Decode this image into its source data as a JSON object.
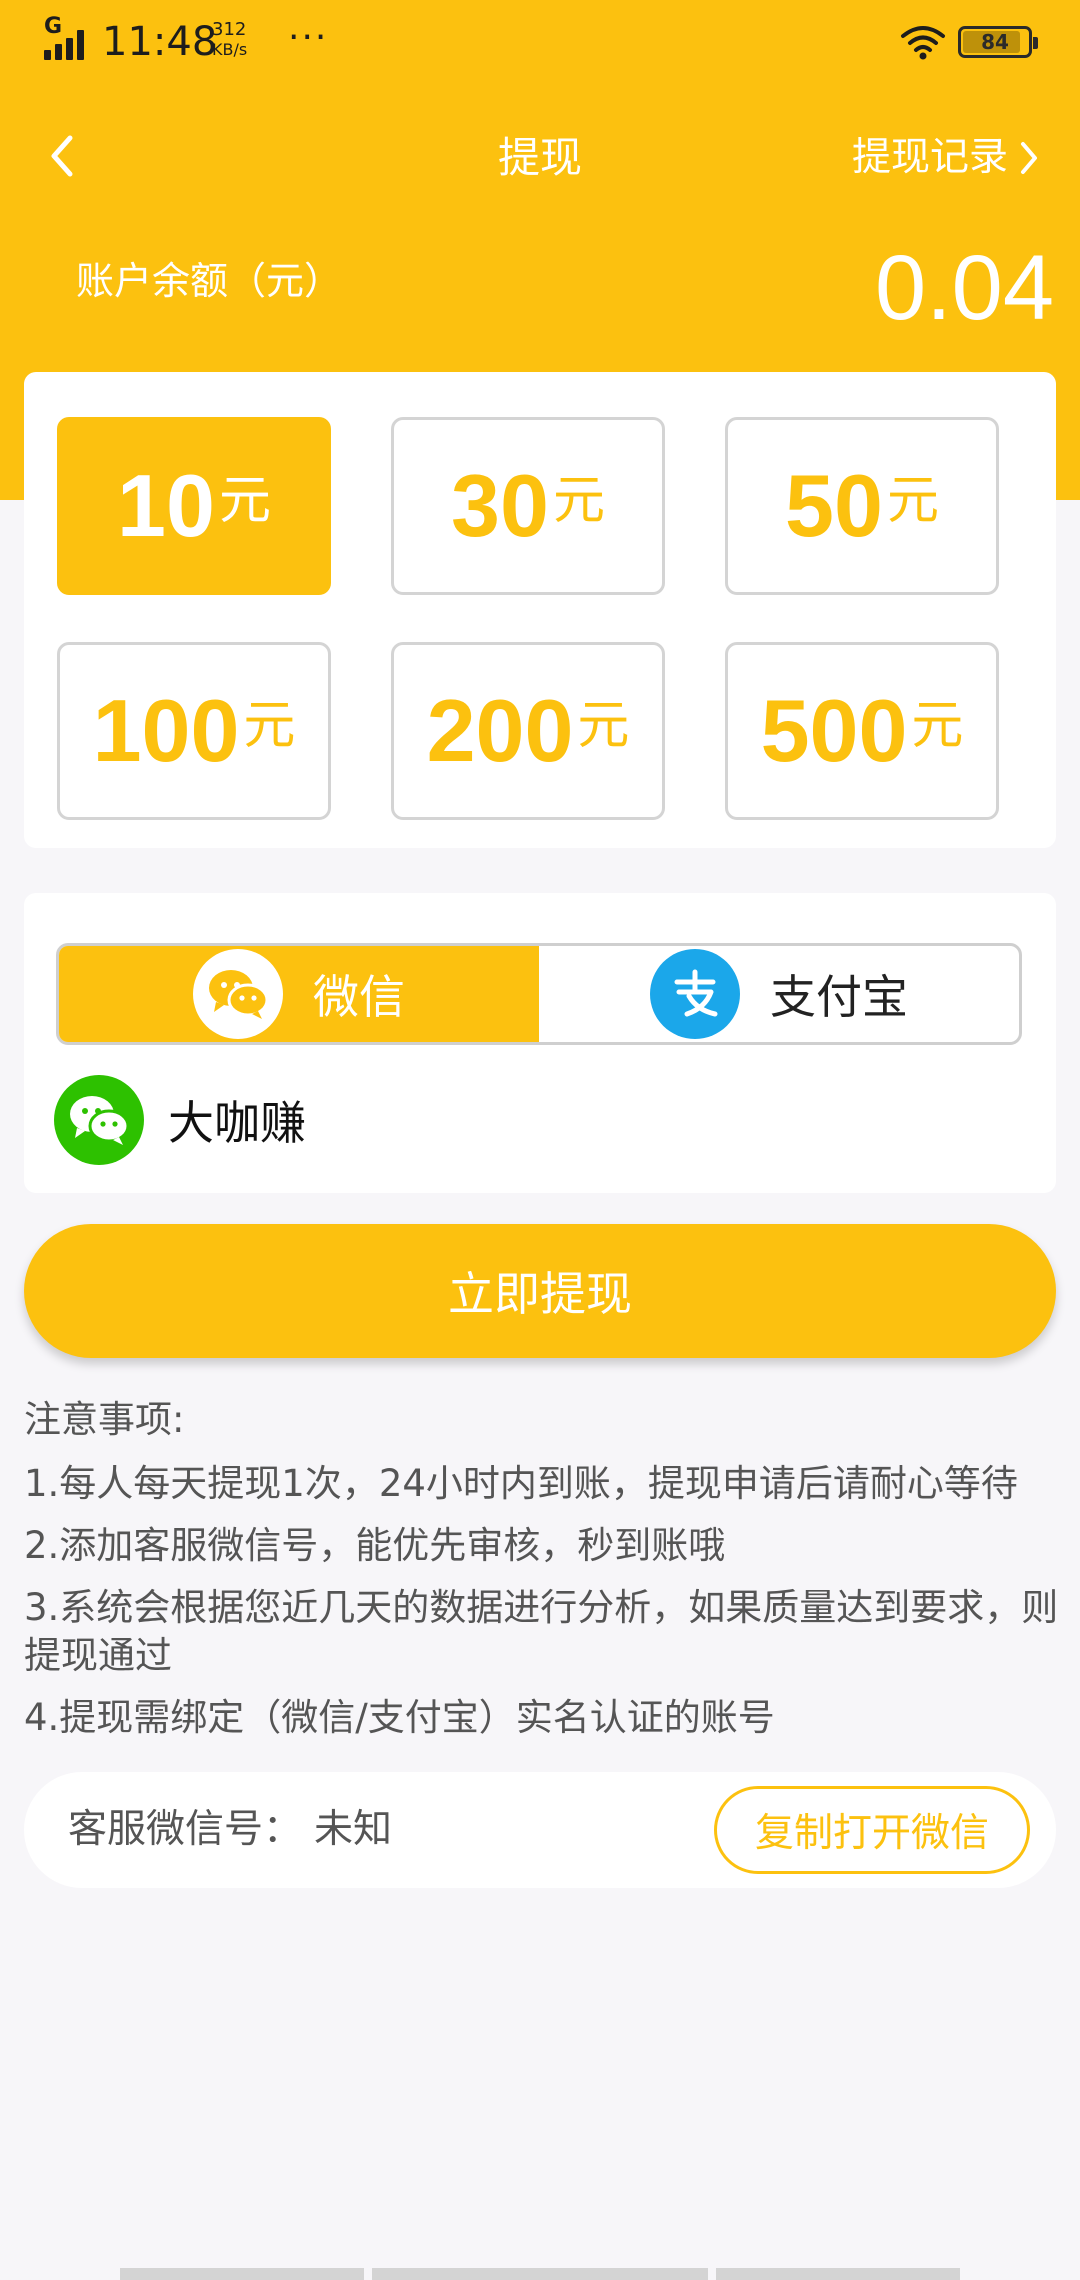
{
  "status_bar": {
    "network": "G",
    "time": "11:48",
    "speed_value": "312",
    "speed_unit": "KB/s",
    "more": "···",
    "battery": "84"
  },
  "nav": {
    "title": "提现",
    "record_label": "提现记录"
  },
  "balance": {
    "label": "账户余额（元）",
    "value": "0.04"
  },
  "amounts": [
    {
      "value": "10",
      "unit": "元",
      "selected": true
    },
    {
      "value": "30",
      "unit": "元",
      "selected": false
    },
    {
      "value": "50",
      "unit": "元",
      "selected": false
    },
    {
      "value": "100",
      "unit": "元",
      "selected": false
    },
    {
      "value": "200",
      "unit": "元",
      "selected": false
    },
    {
      "value": "500",
      "unit": "元",
      "selected": false
    }
  ],
  "payment": {
    "options": [
      {
        "label": "微信",
        "icon": "wechat-icon",
        "active": true
      },
      {
        "label": "支付宝",
        "icon": "alipay-icon",
        "active": false
      }
    ],
    "account_name": "大咖赚"
  },
  "withdraw_button": "立即提现",
  "notes": {
    "title": "注意事项:",
    "items": [
      "1.每人每天提现1次，24小时内到账，提现申请后请耐心等待",
      "2.添加客服微信号，能优先审核，秒到账哦",
      "3.系统会根据您近几天的数据进行分析，如果质量达到要求，则提现通过",
      "4.提现需绑定（微信/支付宝）实名认证的账号"
    ]
  },
  "service": {
    "label": "客服微信号：",
    "value": "未知",
    "copy_button": "复制打开微信"
  },
  "colors": {
    "accent": "#fcc10f",
    "wechat_green": "#2dc100",
    "alipay_blue": "#1ba7ea"
  }
}
